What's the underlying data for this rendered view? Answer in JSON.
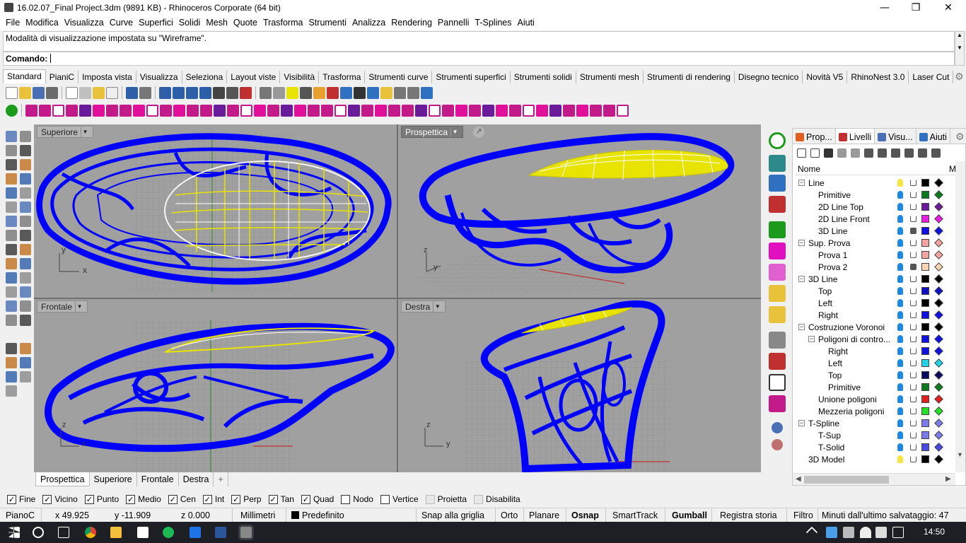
{
  "window": {
    "title": "16.02.07_Final Project.3dm (9891 KB) - Rhinoceros Corporate (64 bit)",
    "minimize_glyph": "—",
    "restore_glyph": "❐",
    "close_glyph": "✕"
  },
  "menu": [
    "File",
    "Modifica",
    "Visualizza",
    "Curve",
    "Superfici",
    "Solidi",
    "Mesh",
    "Quote",
    "Trasforma",
    "Strumenti",
    "Analizza",
    "Rendering",
    "Pannelli",
    "T-Splines",
    "Aiuti"
  ],
  "command": {
    "history": "Modalità di visualizzazione impostata su \"Wireframe\".",
    "prompt": "Comando:",
    "value": ""
  },
  "toolbar_tabs": [
    "Standard",
    "PianiC",
    "Imposta vista",
    "Visualizza",
    "Seleziona",
    "Layout viste",
    "Visibilità",
    "Trasforma",
    "Strumenti curve",
    "Strumenti superfici",
    "Strumenti solidi",
    "Strumenti mesh",
    "Strumenti di rendering",
    "Disegno tecnico",
    "Novità V5",
    "RhinoNest 3.0",
    "Laser Cut"
  ],
  "viewports": {
    "top": {
      "label": "Superiore"
    },
    "perspective": {
      "label": "Prospettica"
    },
    "front": {
      "label": "Frontale"
    },
    "right": {
      "label": "Destra"
    },
    "axis_x": "x",
    "axis_y": "y",
    "axis_z": "z"
  },
  "viewport_tabs": [
    "Prospettica",
    "Superiore",
    "Frontale",
    "Destra"
  ],
  "viewport_tab_add": "+",
  "panel": {
    "tabs": [
      "Prop...",
      "Livelli",
      "Visu...",
      "Aiuti"
    ],
    "col_name": "Nome",
    "col_mat": "M",
    "layers": [
      {
        "name": "Line",
        "level": 0,
        "expander": "−",
        "bulb": "#f5e642",
        "lock": false,
        "color": "#000000",
        "mat": "#000000"
      },
      {
        "name": "Primitive",
        "level": 1,
        "expander": "",
        "bulb": "#1e88e5",
        "lock": false,
        "color": "#0a7a1e",
        "mat": "#0a7a1e"
      },
      {
        "name": "2D Line Top",
        "level": 1,
        "expander": "",
        "bulb": "#1e88e5",
        "lock": false,
        "color": "#6a1b9a",
        "mat": "#6a1b9a"
      },
      {
        "name": "2D Line Front",
        "level": 1,
        "expander": "",
        "bulb": "#1e88e5",
        "lock": false,
        "color": "#e91ee0",
        "mat": "#e91ee0"
      },
      {
        "name": "3D Line",
        "level": 1,
        "expander": "",
        "bulb": "#1e88e5",
        "lock": true,
        "color": "#1010e0",
        "mat": "#1010e0"
      },
      {
        "name": "Sup. Prova",
        "level": 0,
        "expander": "−",
        "bulb": "#1e88e5",
        "lock": false,
        "color": "#f4a3a3",
        "mat": "#f4a3a3"
      },
      {
        "name": "Prova 1",
        "level": 1,
        "expander": "",
        "bulb": "#1e88e5",
        "lock": false,
        "color": "#f4a3a3",
        "mat": "#f4a3a3"
      },
      {
        "name": "Prova 2",
        "level": 1,
        "expander": "",
        "bulb": "#1e88e5",
        "lock": true,
        "color": "#f9d4b0",
        "mat": "#f9d4b0"
      },
      {
        "name": "3D Line",
        "level": 0,
        "expander": "−",
        "bulb": "#1e88e5",
        "lock": false,
        "color": "#000000",
        "mat": "#000000"
      },
      {
        "name": "Top",
        "level": 1,
        "expander": "",
        "bulb": "#1e88e5",
        "lock": false,
        "color": "#1010c0",
        "mat": "#1010c0"
      },
      {
        "name": "Left",
        "level": 1,
        "expander": "",
        "bulb": "#1e88e5",
        "lock": false,
        "color": "#000000",
        "mat": "#000000"
      },
      {
        "name": "Right",
        "level": 1,
        "expander": "",
        "bulb": "#1e88e5",
        "lock": false,
        "color": "#1010e0",
        "mat": "#1010e0"
      },
      {
        "name": "Costruzione Voronoi",
        "level": 0,
        "expander": "−",
        "bulb": "#1e88e5",
        "lock": false,
        "color": "#000000",
        "mat": "#000000"
      },
      {
        "name": "Poligoni di contro...",
        "level": 1,
        "expander": "−",
        "bulb": "#1e88e5",
        "lock": false,
        "color": "#1010e0",
        "mat": "#1010e0"
      },
      {
        "name": "Right",
        "level": 2,
        "expander": "",
        "bulb": "#1e88e5",
        "lock": false,
        "color": "#1010e0",
        "mat": "#1010e0"
      },
      {
        "name": "Left",
        "level": 2,
        "expander": "",
        "bulb": "#1e88e5",
        "lock": false,
        "color": "#22d3e6",
        "mat": "#22d3e6"
      },
      {
        "name": "Top",
        "level": 2,
        "expander": "",
        "bulb": "#1e88e5",
        "lock": false,
        "color": "#0a0a60",
        "mat": "#0a0a60"
      },
      {
        "name": "Primitive",
        "level": 2,
        "expander": "",
        "bulb": "#1e88e5",
        "lock": false,
        "color": "#0a7a1e",
        "mat": "#0a7a1e"
      },
      {
        "name": "Unione poligoni",
        "level": 1,
        "expander": "",
        "bulb": "#1e88e5",
        "lock": false,
        "color": "#e02020",
        "mat": "#e02020"
      },
      {
        "name": "Mezzeria poligoni",
        "level": 1,
        "expander": "",
        "bulb": "#1e88e5",
        "lock": false,
        "color": "#22e022",
        "mat": "#22e022"
      },
      {
        "name": "T-Spline",
        "level": 0,
        "expander": "−",
        "bulb": "#1e88e5",
        "lock": false,
        "color": "#7b7bea",
        "mat": "#7b7bea"
      },
      {
        "name": "T-Sup",
        "level": 1,
        "expander": "",
        "bulb": "#1e88e5",
        "lock": false,
        "color": "#7b7bea",
        "mat": "#7b7bea"
      },
      {
        "name": "T-Solid",
        "level": 1,
        "expander": "",
        "bulb": "#1e88e5",
        "lock": false,
        "color": "#4a4ae0",
        "mat": "#4a4ae0"
      },
      {
        "name": "3D Model",
        "level": 0,
        "expander": "",
        "bulb": "#f5e642",
        "lock": false,
        "color": "#000000",
        "mat": "#000000"
      }
    ]
  },
  "osnap": [
    {
      "label": "Fine",
      "checked": true,
      "disabled": false
    },
    {
      "label": "Vicino",
      "checked": true,
      "disabled": false
    },
    {
      "label": "Punto",
      "checked": true,
      "disabled": false
    },
    {
      "label": "Medio",
      "checked": true,
      "disabled": false
    },
    {
      "label": "Cen",
      "checked": true,
      "disabled": false
    },
    {
      "label": "Int",
      "checked": true,
      "disabled": false
    },
    {
      "label": "Perp",
      "checked": true,
      "disabled": false
    },
    {
      "label": "Tan",
      "checked": true,
      "disabled": false
    },
    {
      "label": "Quad",
      "checked": true,
      "disabled": false
    },
    {
      "label": "Nodo",
      "checked": false,
      "disabled": false
    },
    {
      "label": "Vertice",
      "checked": false,
      "disabled": false
    },
    {
      "label": "Proietta",
      "checked": false,
      "disabled": true
    },
    {
      "label": "Disabilita",
      "checked": false,
      "disabled": true
    }
  ],
  "status": {
    "cplane": "PianoC",
    "x": "x 49.925",
    "y": "y -11.909",
    "z": "z 0.000",
    "units": "Millimetri",
    "layer": "Predefinito",
    "grid_snap": "Snap alla griglia",
    "ortho": "Orto",
    "planar": "Planare",
    "osnap": "Osnap",
    "smarttrack": "SmartTrack",
    "gumball": "Gumball",
    "history": "Registra storia",
    "filter": "Filtro",
    "save": "Minuti dall'ultimo salvataggio: 47"
  },
  "taskbar": {
    "time": "14:50"
  },
  "colors": {
    "wire": "#0000ff",
    "surface": "#e8e300",
    "viewport_bg": "#a0a0a0",
    "grid": "#8a8a8a"
  }
}
